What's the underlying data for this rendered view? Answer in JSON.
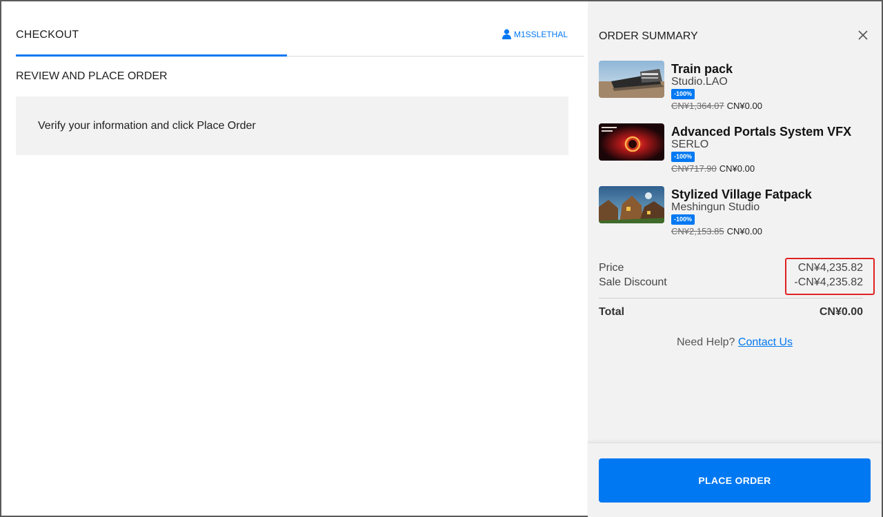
{
  "header": {
    "tab_label": "CHECKOUT",
    "username": "M1SSLETHAL"
  },
  "main": {
    "section_title": "REVIEW AND PLACE ORDER",
    "info_text": "Verify your information and click Place Order"
  },
  "summary": {
    "title": "ORDER SUMMARY",
    "items": [
      {
        "title": "Train pack",
        "publisher": "Studio.LAO",
        "discount": "-100%",
        "original_price": "CN¥1,364.07",
        "price": "CN¥0.00"
      },
      {
        "title": "Advanced Portals System VFX",
        "publisher": "SERLO",
        "discount": "-100%",
        "original_price": "CN¥717.90",
        "price": "CN¥0.00"
      },
      {
        "title": "Stylized Village Fatpack",
        "publisher": "Meshingun Studio",
        "discount": "-100%",
        "original_price": "CN¥2,153.85",
        "price": "CN¥0.00"
      }
    ],
    "price_label": "Price",
    "price_value": "CN¥4,235.82",
    "discount_label": "Sale Discount",
    "discount_value": "-CN¥4,235.82",
    "total_label": "Total",
    "total_value": "CN¥0.00",
    "help_text": "Need Help?",
    "help_link": "Contact Us",
    "place_order_label": "PLACE ORDER"
  },
  "colors": {
    "accent": "#0078f2",
    "highlight_box": "#e02020",
    "panel_bg": "#f2f2f2"
  }
}
